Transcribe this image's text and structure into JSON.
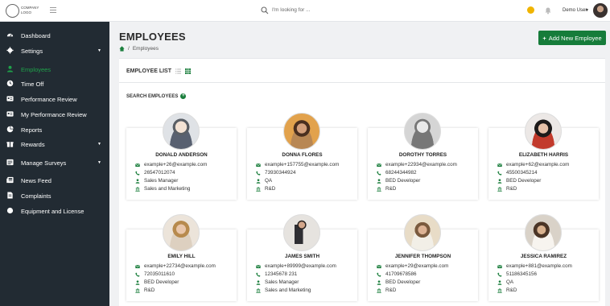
{
  "topbar": {
    "logo_text": "COMPANY LOGO",
    "search_placeholder": "I'm looking for ...",
    "user_name": "Demo User"
  },
  "sidebar": {
    "items": [
      {
        "label": "Dashboard",
        "icon": "dashboard-icon",
        "caret": false,
        "active": false
      },
      {
        "label": "Settings",
        "icon": "gear-icon",
        "caret": true,
        "active": false
      },
      {
        "label": "Employees",
        "icon": "person-icon",
        "caret": false,
        "active": true
      },
      {
        "label": "Time Off",
        "icon": "clock-icon",
        "caret": false,
        "active": false
      },
      {
        "label": "Performance Review",
        "icon": "id-card-icon",
        "caret": false,
        "active": false
      },
      {
        "label": "My Performance Review",
        "icon": "id-card-icon",
        "caret": false,
        "active": false
      },
      {
        "label": "Reports",
        "icon": "pie-chart-icon",
        "caret": false,
        "active": false
      },
      {
        "label": "Rewards",
        "icon": "gift-icon",
        "caret": true,
        "active": false
      },
      {
        "label": "Manage Surveys",
        "icon": "survey-icon",
        "caret": true,
        "active": false
      },
      {
        "label": "News Feed",
        "icon": "newspaper-icon",
        "caret": false,
        "active": false
      },
      {
        "label": "Complaints",
        "icon": "document-icon",
        "caret": false,
        "active": false
      },
      {
        "label": "Equipment and License",
        "icon": "circle-icon",
        "caret": false,
        "active": false
      }
    ]
  },
  "page": {
    "title": "EMPLOYEES",
    "add_button": "Add New Employee",
    "breadcrumb_current": "Employees",
    "list_title": "EMPLOYEE LIST",
    "search_label": "SEARCH EMPLOYEES"
  },
  "employees": [
    {
      "name": "DONALD ANDERSON",
      "email": "example+26@example.com",
      "phone": "26547012074",
      "role": "Sales Manager",
      "department": "Sales and Marketing",
      "photo": "illustrated-avatar"
    },
    {
      "name": "DONNA FLORES",
      "email": "example+157755@example.com",
      "phone": "73930344924",
      "role": "QA",
      "department": "R&D",
      "photo": "photo-woman"
    },
    {
      "name": "DOROTHY TORRES",
      "email": "example+22934@example.com",
      "phone": "68244344982",
      "role": "BED Developer",
      "department": "R&D",
      "photo": "illustrated-avatar-gray"
    },
    {
      "name": "ELIZABETH HARRIS",
      "email": "example+62@example.com",
      "phone": "45500345214",
      "role": "BED Developer",
      "department": "R&D",
      "photo": "photo-woman-glasses"
    },
    {
      "name": "EMILY HILL",
      "email": "example+22734@example.com",
      "phone": "72035011610",
      "role": "BED Developer",
      "department": "R&D",
      "photo": "photo-woman-blonde"
    },
    {
      "name": "JAMES SMITH",
      "email": "example+89999@example.com",
      "phone": "12345678 231",
      "role": "Sales Manager",
      "department": "Sales and Marketing",
      "photo": "photo-man-suit"
    },
    {
      "name": "JENNIFER THOMPSON",
      "email": "example+29@example.com",
      "phone": "41709678586",
      "role": "BED Developer",
      "department": "R&D",
      "photo": "photo-woman-desk"
    },
    {
      "name": "JESSICA RAMIREZ",
      "email": "example+881@example.com",
      "phone": "51186345156",
      "role": "QA",
      "department": "R&D",
      "photo": "photo-woman-laptop"
    }
  ],
  "colors": {
    "sidebar_bg": "#222b33",
    "accent_green": "#167c3a",
    "active_green": "#1fa24a",
    "icon_green": "#1a7e3c"
  }
}
